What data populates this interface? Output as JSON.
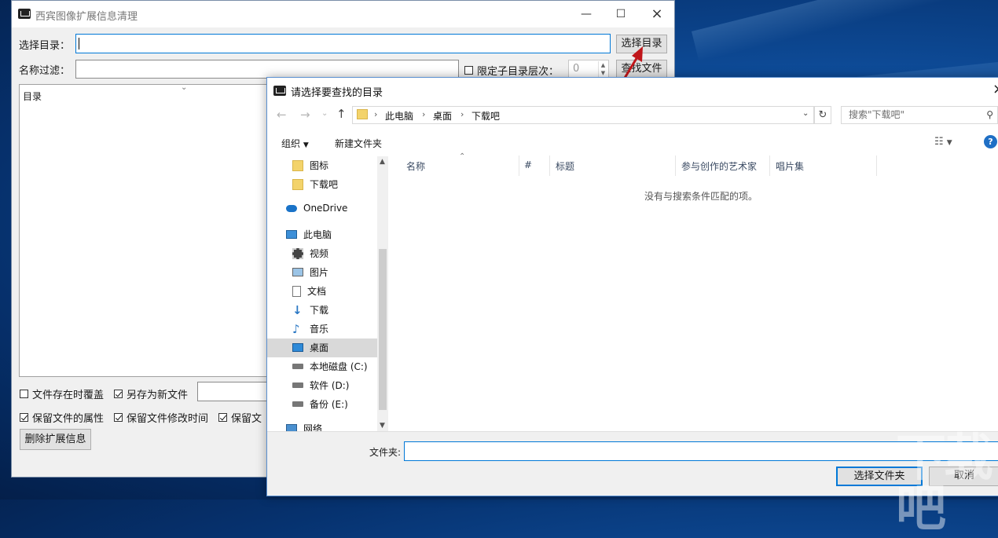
{
  "app": {
    "title": "西宾图像扩展信息清理",
    "select_dir_label": "选择目录：",
    "select_dir_value": "",
    "select_dir_button": "选择目录",
    "name_filter_label": "名称过滤：",
    "name_filter_value": "",
    "limit_depth_label": "限定子目录层次：",
    "limit_depth_checked": false,
    "depth_value": "0",
    "find_files_button": "查找文件",
    "list_header": "目录",
    "overwrite_label": "文件存在时覆盖",
    "overwrite_checked": false,
    "save_as_new_label": "另存为新文件",
    "save_as_new_checked": true,
    "keep_attr_label": "保留文件的属性",
    "keep_attr_checked": true,
    "keep_mtime_label": "保留文件修改时间",
    "keep_mtime_checked": true,
    "keep_more_label": "保留文",
    "keep_more_checked": true,
    "delete_button": "删除扩展信息"
  },
  "dialog": {
    "title": "请选择要查找的目录",
    "breadcrumb": [
      "此电脑",
      "桌面",
      "下载吧"
    ],
    "search_placeholder": "搜索\"下载吧\"",
    "organize": "组织",
    "new_folder": "新建文件夹",
    "nav": [
      {
        "label": "图标",
        "icon": "folder-icon"
      },
      {
        "label": "下载吧",
        "icon": "folder-icon"
      },
      {
        "label": "OneDrive",
        "icon": "cloud-icon"
      },
      {
        "label": "此电脑",
        "icon": "computer-icon"
      },
      {
        "label": "视频",
        "icon": "video-icon"
      },
      {
        "label": "图片",
        "icon": "picture-icon"
      },
      {
        "label": "文档",
        "icon": "document-icon"
      },
      {
        "label": "下载",
        "icon": "download-icon"
      },
      {
        "label": "音乐",
        "icon": "music-icon"
      },
      {
        "label": "桌面",
        "icon": "desktop-icon"
      },
      {
        "label": "本地磁盘 (C:)",
        "icon": "drive-icon"
      },
      {
        "label": "软件 (D:)",
        "icon": "drive-icon"
      },
      {
        "label": "备份 (E:)",
        "icon": "drive-icon"
      },
      {
        "label": "网络",
        "icon": "network-icon"
      }
    ],
    "columns": [
      "名称",
      "#",
      "标题",
      "参与创作的艺术家",
      "唱片集"
    ],
    "empty_message": "没有与搜索条件匹配的项。",
    "folder_label": "文件夹:",
    "folder_value": "",
    "select_folder_button": "选择文件夹",
    "cancel_button": "取消"
  },
  "watermark": "下载吧"
}
